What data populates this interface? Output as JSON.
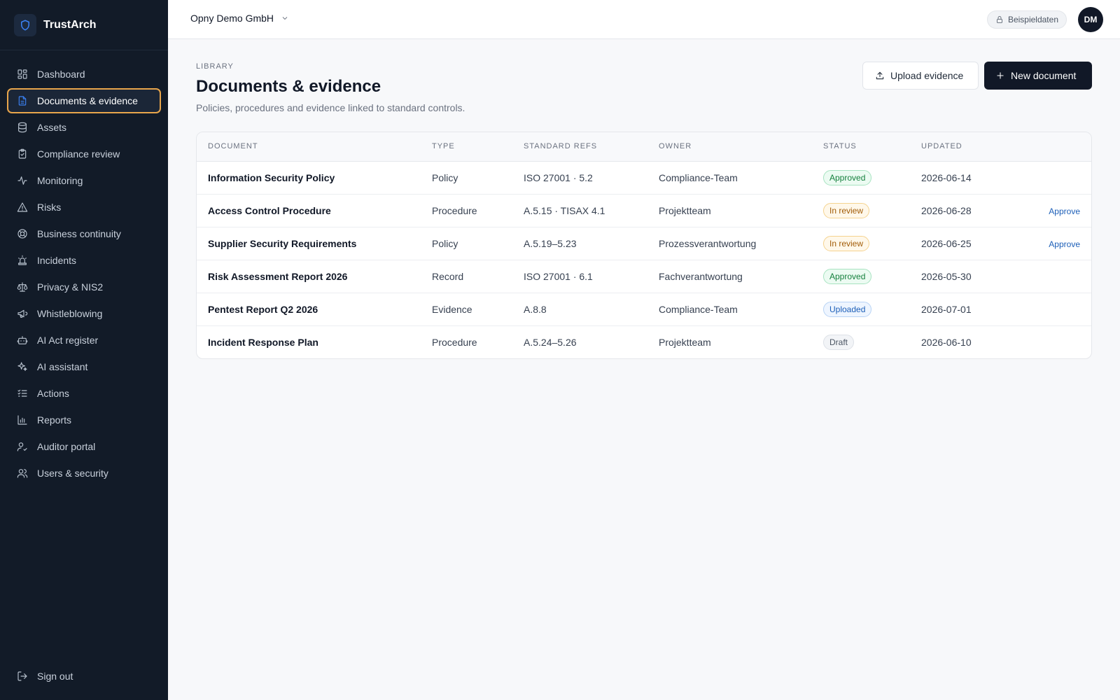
{
  "app": {
    "name": "TrustArch",
    "logo_icon": "shield-icon"
  },
  "sidebar": {
    "items": [
      {
        "label": "Dashboard",
        "icon": "dashboard-icon"
      },
      {
        "label": "Documents & evidence",
        "icon": "document-icon",
        "active": true
      },
      {
        "label": "Assets",
        "icon": "database-icon"
      },
      {
        "label": "Compliance review",
        "icon": "clipboard-check-icon"
      },
      {
        "label": "Monitoring",
        "icon": "activity-icon"
      },
      {
        "label": "Risks",
        "icon": "warning-icon"
      },
      {
        "label": "Business continuity",
        "icon": "lifebuoy-icon"
      },
      {
        "label": "Incidents",
        "icon": "siren-icon"
      },
      {
        "label": "Privacy & NIS2",
        "icon": "scale-icon"
      },
      {
        "label": "Whistleblowing",
        "icon": "megaphone-icon"
      },
      {
        "label": "AI Act register",
        "icon": "robot-icon"
      },
      {
        "label": "AI assistant",
        "icon": "sparkles-icon"
      },
      {
        "label": "Actions",
        "icon": "list-checks-icon"
      },
      {
        "label": "Reports",
        "icon": "bar-chart-icon"
      },
      {
        "label": "Auditor portal",
        "icon": "user-check-icon"
      },
      {
        "label": "Users & security",
        "icon": "users-icon"
      }
    ],
    "signout_label": "Sign out"
  },
  "topbar": {
    "org_name": "Opny Demo GmbH",
    "sample_badge": "Beispieldaten",
    "avatar_initials": "DM"
  },
  "page": {
    "eyebrow": "LIBRARY",
    "title": "Documents & evidence",
    "subtitle": "Policies, procedures and evidence linked to standard controls.",
    "upload_label": "Upload evidence",
    "new_label": "New document"
  },
  "table": {
    "columns": [
      "DOCUMENT",
      "TYPE",
      "STANDARD REFS",
      "OWNER",
      "STATUS",
      "UPDATED"
    ],
    "rows": [
      {
        "document": "Information Security Policy",
        "type": "Policy",
        "refs": "ISO 27001 · 5.2",
        "owner": "Compliance-Team",
        "status": "Approved",
        "updated": "2026-06-14",
        "action": ""
      },
      {
        "document": "Access Control Procedure",
        "type": "Procedure",
        "refs": "A.5.15 · TISAX 4.1",
        "owner": "Projektteam",
        "status": "In review",
        "updated": "2026-06-28",
        "action": "Approve"
      },
      {
        "document": "Supplier Security Requirements",
        "type": "Policy",
        "refs": "A.5.19–5.23",
        "owner": "Prozessverantwortung",
        "status": "In review",
        "updated": "2026-06-25",
        "action": "Approve"
      },
      {
        "document": "Risk Assessment Report 2026",
        "type": "Record",
        "refs": "ISO 27001 · 6.1",
        "owner": "Fachverantwortung",
        "status": "Approved",
        "updated": "2026-05-30",
        "action": ""
      },
      {
        "document": "Pentest Report Q2 2026",
        "type": "Evidence",
        "refs": "A.8.8",
        "owner": "Compliance-Team",
        "status": "Uploaded",
        "updated": "2026-07-01",
        "action": ""
      },
      {
        "document": "Incident Response Plan",
        "type": "Procedure",
        "refs": "A.5.24–5.26",
        "owner": "Projektteam",
        "status": "Draft",
        "updated": "2026-06-10",
        "action": ""
      }
    ]
  }
}
